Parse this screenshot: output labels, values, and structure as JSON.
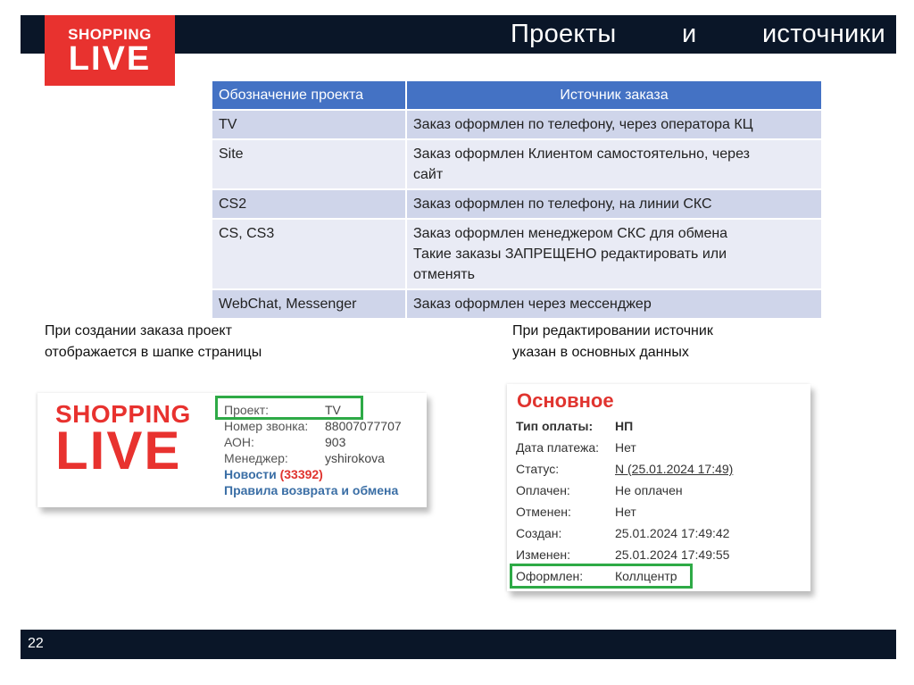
{
  "header": {
    "logo_line1": "SHOPPING",
    "logo_line2": "LIVE",
    "title_words": [
      "Проекты",
      "и",
      "источники"
    ]
  },
  "table": {
    "headers": [
      "Обозначение проекта",
      "Источник заказа"
    ],
    "rows": [
      {
        "project": "TV",
        "source_lines": [
          "Заказ оформлен по телефону, через оператора КЦ"
        ]
      },
      {
        "project": "Site",
        "source_lines": [
          "Заказ оформлен Клиентом самостоятельно, через",
          "сайт"
        ]
      },
      {
        "project": "CS2",
        "source_lines": [
          "Заказ оформлен по телефону, на линии СКС"
        ]
      },
      {
        "project": "CS, CS3",
        "source_lines": [
          "Заказ оформлен менеджером СКС для обмена",
          "Такие заказы ЗАПРЕЩЕНО редактировать или",
          "отменять"
        ]
      },
      {
        "project": "WebChat, Messenger",
        "source_lines": [
          "Заказ оформлен через мессенджер"
        ]
      }
    ]
  },
  "captions": {
    "left_lines": [
      "При создании заказа проект",
      "отображается в шапке страницы"
    ],
    "right_lines": [
      "При редактировании источник",
      "указан в основных данных"
    ]
  },
  "order_header_shot": {
    "logo_line1": "SHOPPING",
    "logo_line2": "LIVE",
    "fields": [
      {
        "label": "Проект:",
        "value": "TV"
      },
      {
        "label": "Номер звонка:",
        "value": "88007077707"
      },
      {
        "label": "АОН:",
        "value": "903"
      },
      {
        "label": "Менеджер:",
        "value": "yshirokova"
      }
    ],
    "news_label": "Новости",
    "news_count": "(33392)",
    "rules_link": "Правила возврата и обмена"
  },
  "main_data_shot": {
    "title": "Основное",
    "rows": [
      {
        "label": "Тип оплаты:",
        "value": "НП"
      },
      {
        "label": "Дата платежа:",
        "value": "Нет"
      },
      {
        "label": "Статус:",
        "value": "N (25.01.2024 17:49)"
      },
      {
        "label": "Оплачен:",
        "value": "Не оплачен"
      },
      {
        "label": "Отменен:",
        "value": "Нет"
      },
      {
        "label": "Создан:",
        "value": "25.01.2024 17:49:42"
      },
      {
        "label": "Изменен:",
        "value": "25.01.2024 17:49:55"
      },
      {
        "label": "Оформлен:",
        "value": "Коллцентр"
      }
    ]
  },
  "footer": {
    "page_number": "22"
  },
  "colors": {
    "brand_red": "#e8322f",
    "header_dark": "#0a1628",
    "table_header": "#4472c4",
    "highlight_green": "#2eaa46"
  }
}
